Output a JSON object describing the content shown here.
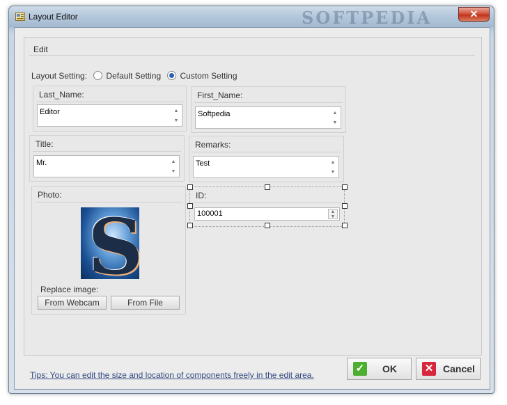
{
  "window": {
    "title": "Layout Editor",
    "watermark": "SOFTPEDIA",
    "close_glyph": "✕"
  },
  "edit_area": {
    "label": "Edit"
  },
  "layout_setting": {
    "label": "Layout Setting:",
    "options": [
      "Default Setting",
      "Custom Setting"
    ],
    "selected": "Custom Setting"
  },
  "fields": {
    "last_name": {
      "label": "Last_Name:",
      "value": "Editor"
    },
    "first_name": {
      "label": "First_Name:",
      "value": "Softpedia"
    },
    "title": {
      "label": "Title:",
      "value": "Mr."
    },
    "remarks": {
      "label": "Remarks:",
      "value": "Test"
    },
    "id": {
      "label": "ID:",
      "value": "100001"
    }
  },
  "photo": {
    "label": "Photo:",
    "replace_label": "Replace image:",
    "webcam_button": "From Webcam",
    "file_button": "From File"
  },
  "footer": {
    "tips": "Tips: You can edit the size and location of components freely in the edit area.",
    "ok_label": "OK",
    "cancel_label": "Cancel"
  },
  "colors": {
    "ok_icon": "#4caf32",
    "cancel_icon": "#d7263d",
    "tips_link": "#334a80"
  }
}
